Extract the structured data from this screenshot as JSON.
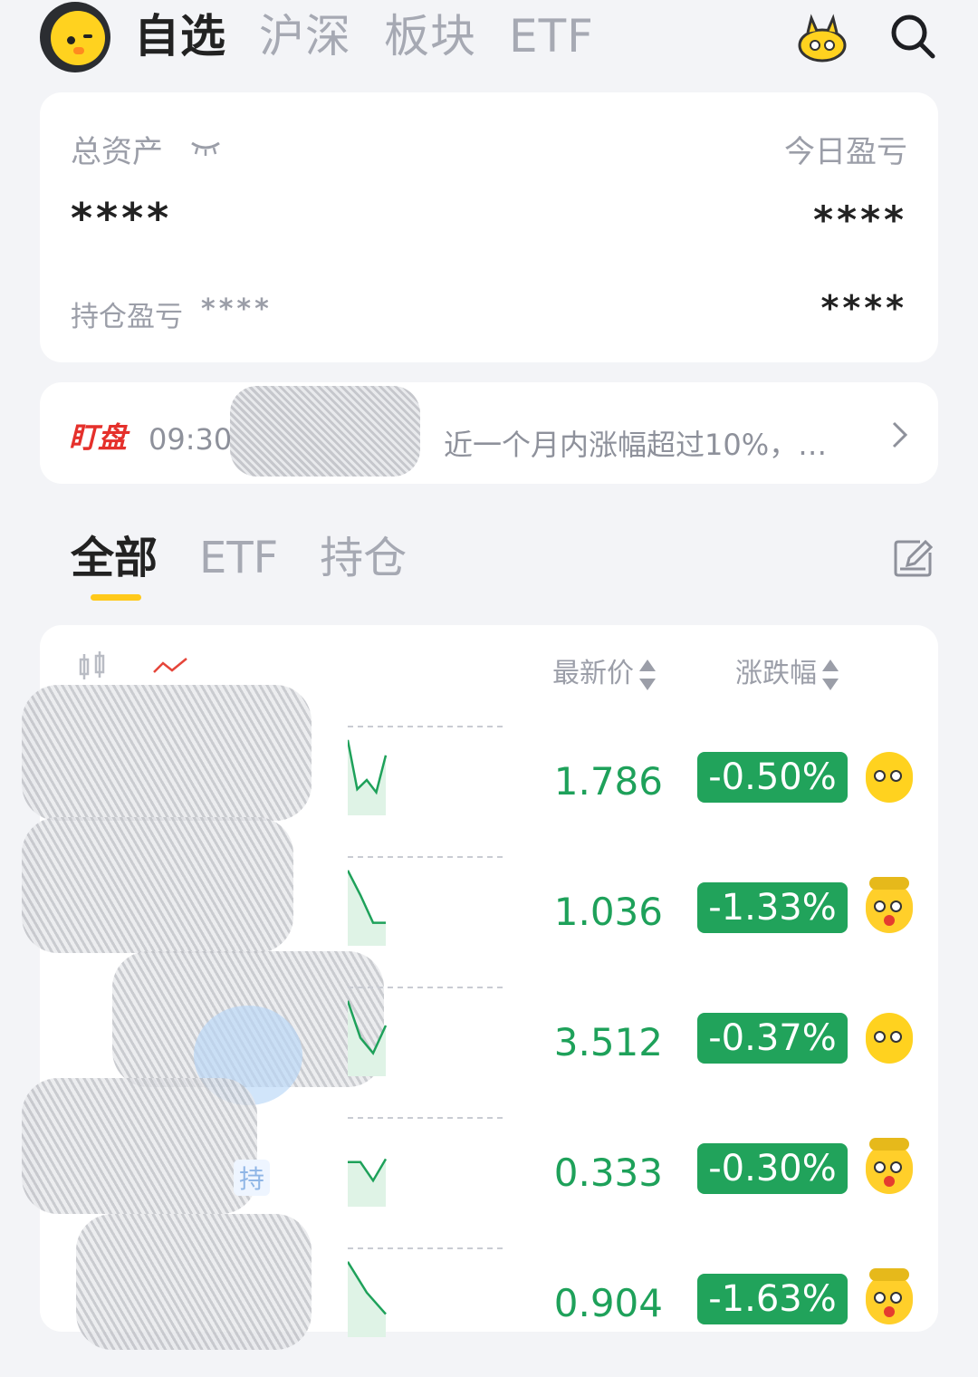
{
  "header": {
    "tabs": [
      "自选",
      "沪深",
      "板块",
      "ETF"
    ],
    "active_tab_index": 0,
    "icons": [
      "avatar",
      "mascot-icon",
      "search-icon"
    ]
  },
  "asset_card": {
    "total_assets_label": "总资产",
    "total_assets_value": "****",
    "today_pnl_label": "今日盈亏",
    "today_pnl_value": "****",
    "holding_pnl_label": "持仓盈亏",
    "holding_pnl_value": "****",
    "holding_pnl_right_value": "****"
  },
  "notice": {
    "logo": "盯盘",
    "time": "09:30",
    "text": "近一个月内涨幅超过10%，…"
  },
  "filter_tabs": {
    "items": [
      "全部",
      "ETF",
      "持仓"
    ],
    "active_index": 0
  },
  "list": {
    "col_price": "最新价",
    "col_change": "涨跌幅",
    "hold_tag": "持",
    "rows": [
      {
        "price": "1.786",
        "change": "-0.50%",
        "emoji": "eyes",
        "spark": [
          0.1,
          0.9,
          0.75,
          0.95,
          0.35
        ]
      },
      {
        "price": "1.036",
        "change": "-1.33%",
        "emoji": "dizzy",
        "spark": [
          0.1,
          0.5,
          0.95,
          0.95
        ]
      },
      {
        "price": "3.512",
        "change": "-0.37%",
        "emoji": "eyes",
        "spark": [
          0.1,
          0.7,
          0.95,
          0.5
        ]
      },
      {
        "price": "0.333",
        "change": "-0.30%",
        "emoji": "dizzy",
        "spark": [
          0.6,
          0.6,
          0.9,
          0.55
        ]
      },
      {
        "price": "0.904",
        "change": "-1.63%",
        "emoji": "dizzy",
        "spark": [
          0.1,
          0.6,
          0.95
        ]
      }
    ]
  }
}
